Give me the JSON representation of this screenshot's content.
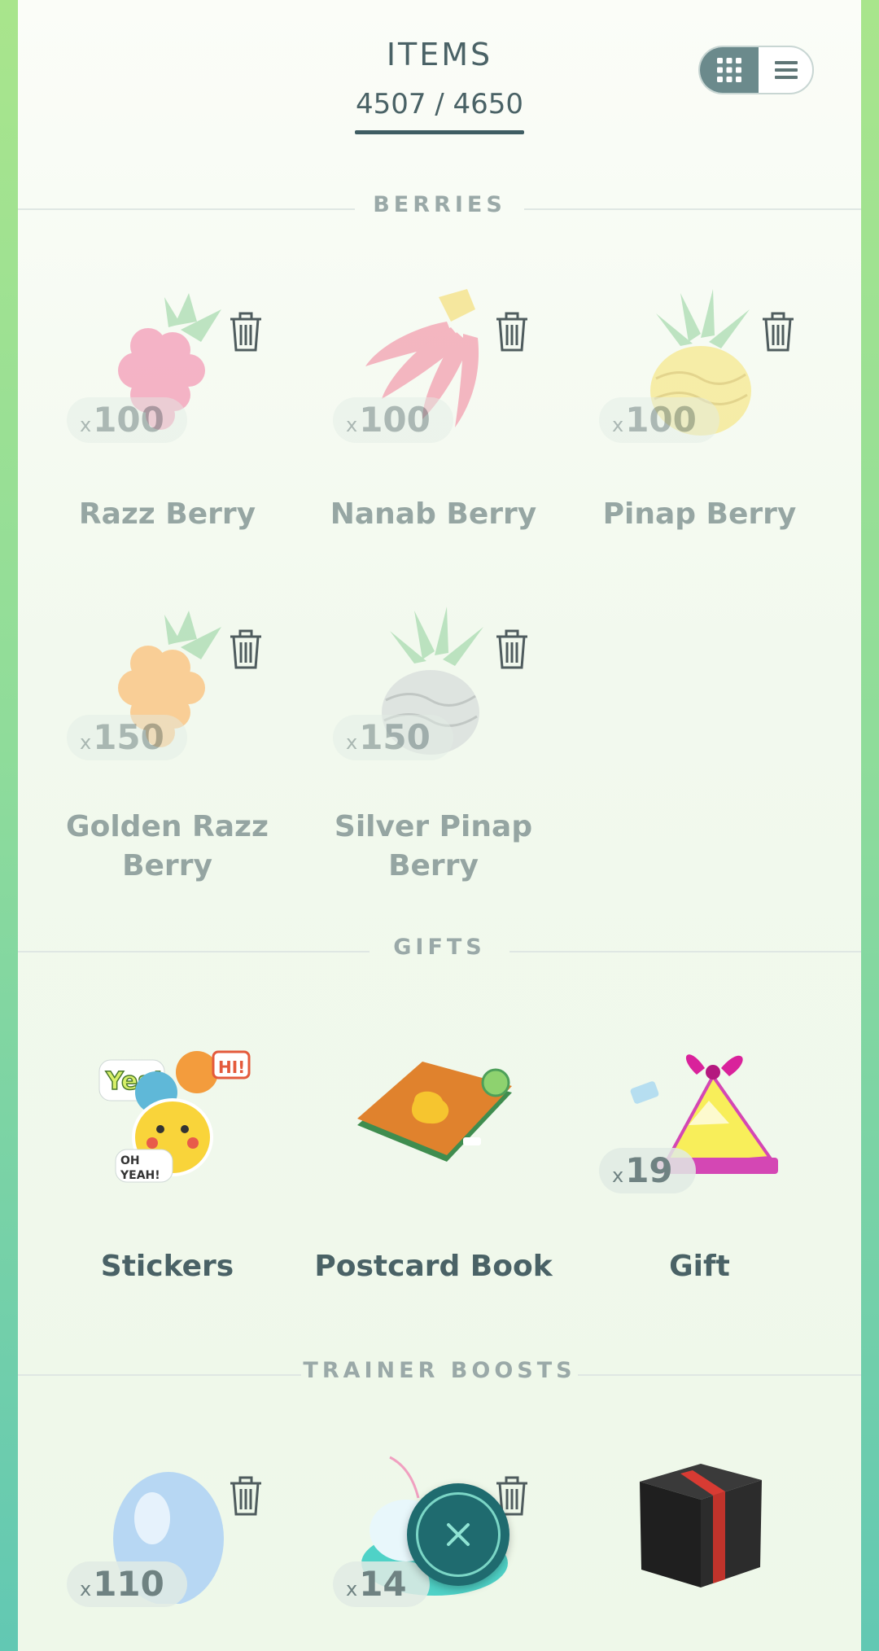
{
  "header": {
    "title": "ITEMS",
    "count": "4507 / 4650"
  },
  "view_toggle": {
    "grid_icon": "grid-icon",
    "list_icon": "list-icon",
    "selected": "grid"
  },
  "sections": {
    "berries": "BERRIES",
    "gifts": "GIFTS",
    "trainer_boosts": "TRAINER BOOSTS"
  },
  "berries": [
    {
      "name": "Razz Berry",
      "count_prefix": "x",
      "count": "100",
      "icon": "razz-berry-icon"
    },
    {
      "name": "Nanab Berry",
      "count_prefix": "x",
      "count": "100",
      "icon": "nanab-berry-icon"
    },
    {
      "name": "Pinap Berry",
      "count_prefix": "x",
      "count": "100",
      "icon": "pinap-berry-icon"
    },
    {
      "name": "Golden Razz Berry",
      "count_prefix": "x",
      "count": "150",
      "icon": "golden-razz-berry-icon"
    },
    {
      "name": "Silver Pinap Berry",
      "count_prefix": "x",
      "count": "150",
      "icon": "silver-pinap-berry-icon"
    }
  ],
  "gifts": [
    {
      "name": "Stickers",
      "icon": "stickers-icon"
    },
    {
      "name": "Postcard Book",
      "icon": "postcard-book-icon"
    },
    {
      "name": "Gift",
      "count_prefix": "x",
      "count": "19",
      "icon": "gift-icon"
    }
  ],
  "trainer_boosts": [
    {
      "count_prefix": "x",
      "count": "110",
      "icon": "egg-icon"
    },
    {
      "count_prefix": "x",
      "count": "14",
      "icon": "incubator-icon"
    },
    {
      "icon": "black-box-icon"
    }
  ],
  "fab": {
    "icon": "close-icon"
  },
  "colors": {
    "text": "#4a6266",
    "accent": "#1f6b6f",
    "section_label": "#9aa9a8"
  }
}
